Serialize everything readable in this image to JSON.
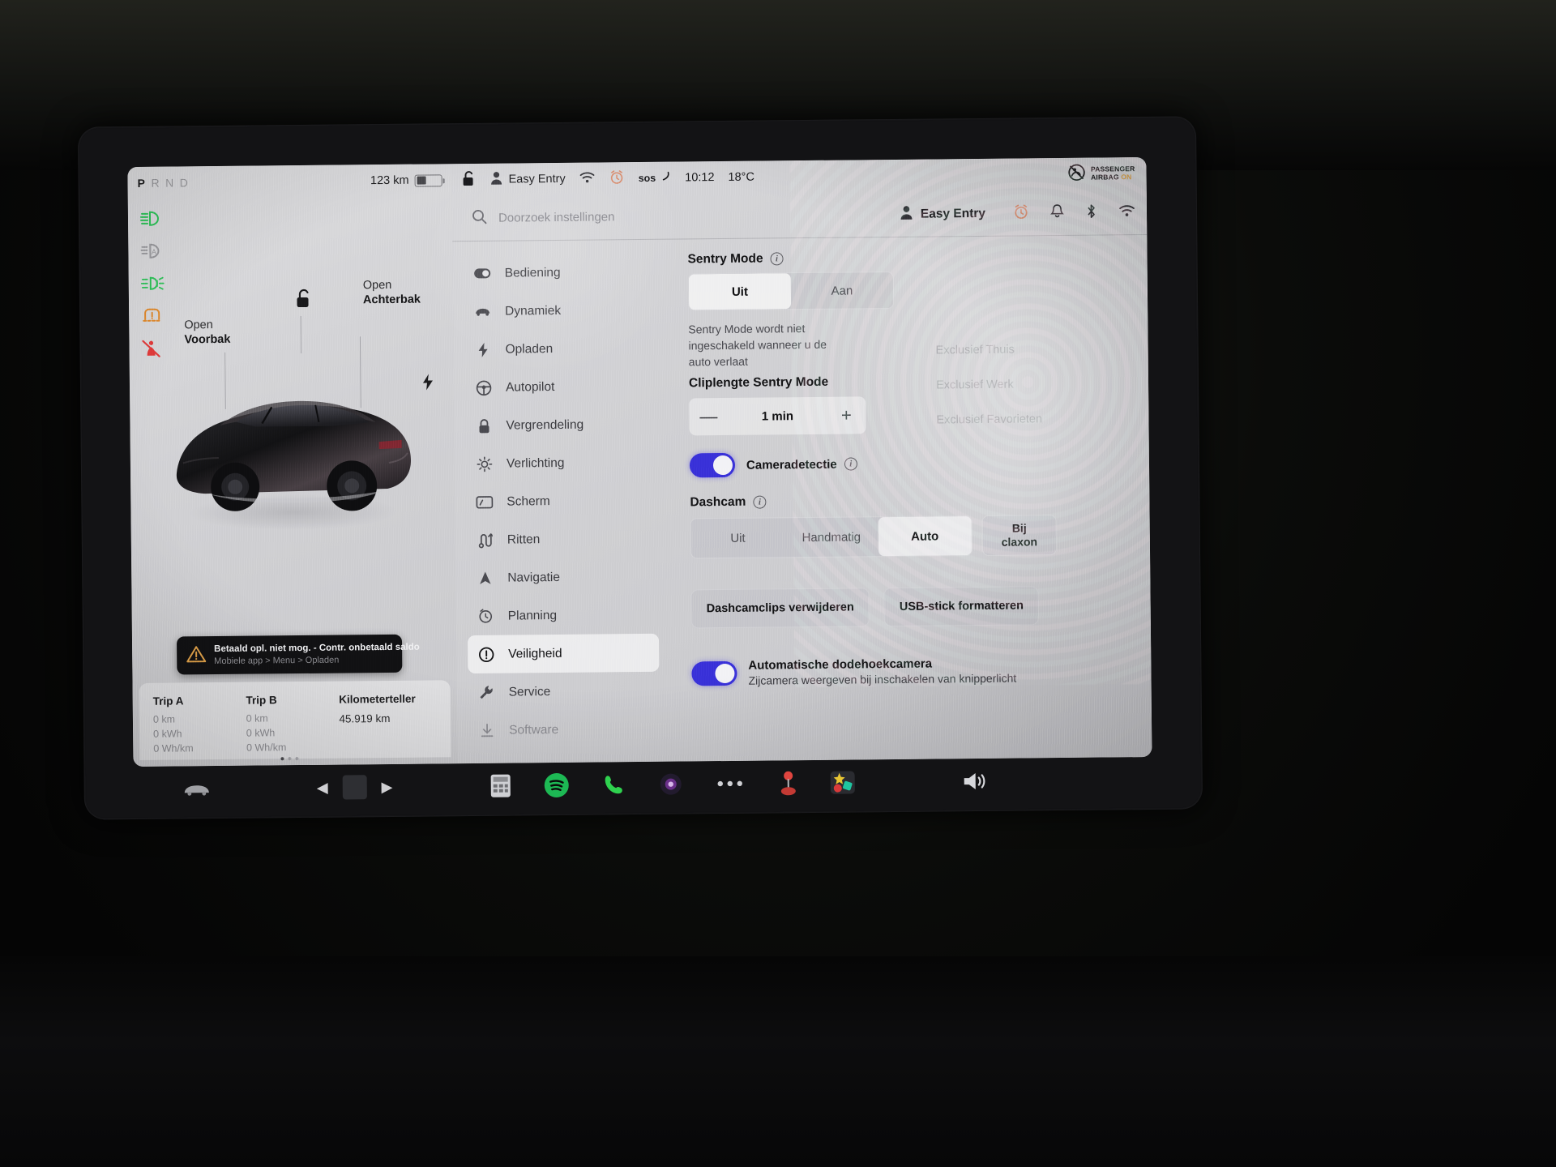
{
  "left_pane": {
    "gear": {
      "letters": [
        "P",
        "R",
        "N",
        "D"
      ],
      "selected": "P"
    },
    "range": "123 km",
    "battery_percent": 38,
    "tell_tales": [
      {
        "name": "low-beam-icon",
        "color": "#2fc45a"
      },
      {
        "name": "auto-high-beam-icon",
        "color": "#9a9a9e"
      },
      {
        "name": "front-fog-light-icon",
        "color": "#2fc45a"
      },
      {
        "name": "tire-pressure-warning-icon",
        "color": "#e08a2c"
      },
      {
        "name": "seatbelt-warning-icon",
        "color": "#e03b3b"
      }
    ],
    "labels": {
      "front_trunk": {
        "line1": "Open",
        "line2": "Voorbak"
      },
      "rear_trunk": {
        "line1": "Open",
        "line2": "Achterbak"
      }
    },
    "notification": {
      "title": "Betaald opl. niet mog. - Contr. onbetaald saldo",
      "subtitle": "Mobiele app > Menu > Opladen"
    },
    "trip": {
      "columns": [
        {
          "title": "Trip A",
          "values": [
            "0 km",
            "0 kWh",
            "0 Wh/km"
          ]
        },
        {
          "title": "Trip B",
          "values": [
            "0 km",
            "0 kWh",
            "0 Wh/km"
          ]
        }
      ],
      "odometer": {
        "title": "Kilometerteller",
        "value": "45.919 km"
      }
    }
  },
  "status_bar": {
    "lock_icon": "unlock-icon",
    "profile": "Easy Entry",
    "wifi_icon": "wifi-icon",
    "alarm_icon": "alarm-clock-icon",
    "sos_label": "sos",
    "time": "10:12",
    "temperature": "18°C",
    "airbag": {
      "line1": "PASSENGER",
      "line2": "AIRBAG",
      "state": "ON"
    }
  },
  "settings": {
    "search": {
      "placeholder": "Doorzoek instellingen"
    },
    "profile": "Easy Entry",
    "quick_icons": [
      "alarm-clock-icon",
      "bell-icon",
      "bluetooth-icon",
      "wifi-icon"
    ],
    "menu": [
      {
        "label": "Bediening",
        "icon": "toggle-icon",
        "active": false
      },
      {
        "label": "Dynamiek",
        "icon": "car-icon",
        "active": false
      },
      {
        "label": "Opladen",
        "icon": "bolt-icon",
        "active": false
      },
      {
        "label": "Autopilot",
        "icon": "steering-wheel-icon",
        "active": false
      },
      {
        "label": "Vergrendeling",
        "icon": "lock-icon",
        "active": false
      },
      {
        "label": "Verlichting",
        "icon": "sun-icon",
        "active": false
      },
      {
        "label": "Scherm",
        "icon": "display-icon",
        "active": false
      },
      {
        "label": "Ritten",
        "icon": "trip-route-icon",
        "active": false
      },
      {
        "label": "Navigatie",
        "icon": "navigation-arrow-icon",
        "active": false
      },
      {
        "label": "Planning",
        "icon": "schedule-clock-icon",
        "active": false
      },
      {
        "label": "Veiligheid",
        "icon": "warning-circle-icon",
        "active": true
      },
      {
        "label": "Service",
        "icon": "wrench-icon",
        "active": false
      },
      {
        "label": "Software",
        "icon": "download-icon",
        "active": false
      }
    ],
    "sentry": {
      "title": "Sentry Mode",
      "options": [
        "Uit",
        "Aan"
      ],
      "selected": "Uit",
      "hint": "Sentry Mode wordt niet ingeschakeld wanneer u de auto verlaat"
    },
    "clip_length": {
      "title": "Cliplengte Sentry Mode",
      "value": "1 min",
      "minus": "—",
      "plus": "+"
    },
    "camera_detection": {
      "label": "Cameradetectie",
      "enabled": true
    },
    "dashcam": {
      "title": "Dashcam",
      "options": [
        "Uit",
        "Handmatig",
        "Auto"
      ],
      "selected": "Auto",
      "honk_button": {
        "line1": "Bij",
        "line2": "claxon"
      }
    },
    "actions": [
      {
        "label": "Dashcamclips verwijderen"
      },
      {
        "label": "USB-stick formatteren"
      }
    ],
    "blindspot": {
      "label": "Automatische dodehoekcamera",
      "sub": "Zijcamera weergeven bij inschakelen van knipperlicht",
      "enabled": true
    },
    "exclusions": [
      "Exclusief Thuis",
      "Exclusief Werk",
      "Exclusief Favorieten"
    ]
  },
  "taskbar": {
    "items": [
      {
        "name": "car-icon"
      },
      {
        "name": "media-player"
      },
      {
        "name": "calculator-icon"
      },
      {
        "name": "spotify-icon"
      },
      {
        "name": "phone-icon"
      },
      {
        "name": "camera-icon"
      },
      {
        "name": "more-icon"
      },
      {
        "name": "joystick-icon"
      },
      {
        "name": "games-icon"
      },
      {
        "name": "volume-icon"
      }
    ]
  },
  "colors": {
    "accent_blue": "#3a32d9",
    "green": "#2fc45a",
    "amber": "#e08a2c",
    "red": "#e03b3b",
    "screen_bg": "#d2d2d5"
  }
}
